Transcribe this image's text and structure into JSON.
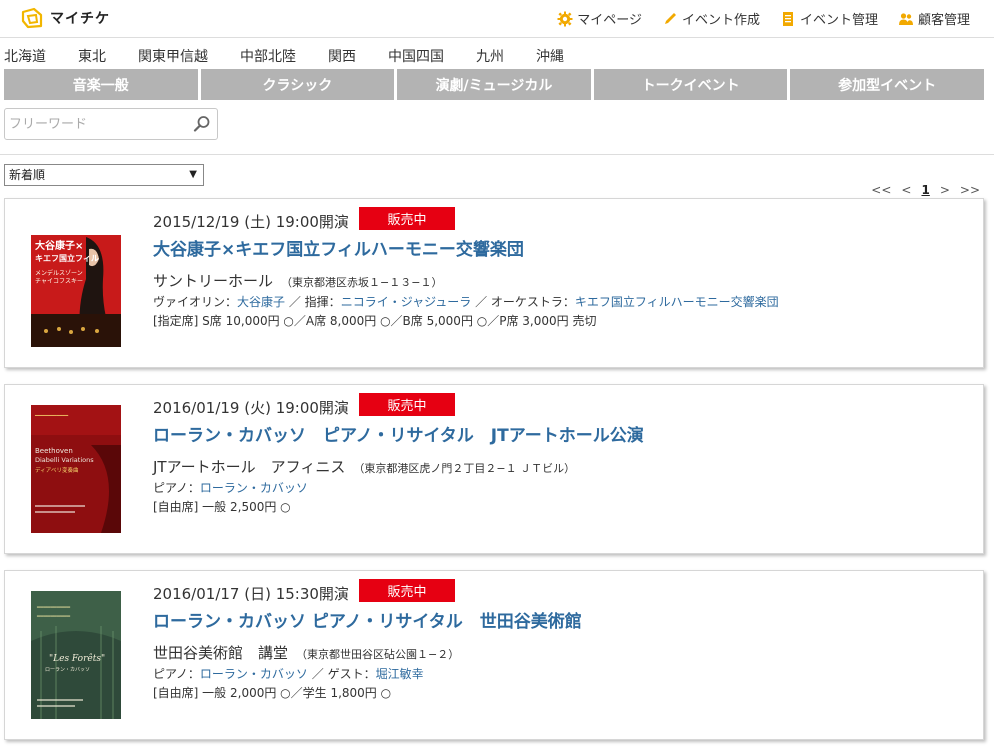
{
  "header": {
    "logo_text": "マイチケ",
    "nav": [
      {
        "label": "マイページ",
        "icon": "gear-icon"
      },
      {
        "label": "イベント作成",
        "icon": "pencil-icon"
      },
      {
        "label": "イベント管理",
        "icon": "document-icon"
      },
      {
        "label": "顧客管理",
        "icon": "users-icon"
      }
    ]
  },
  "regions": [
    "北海道",
    "東北",
    "関東甲信越",
    "中部北陸",
    "関西",
    "中国四国",
    "九州",
    "沖縄"
  ],
  "categories": [
    "音楽一般",
    "クラシック",
    "演劇/ミュージカル",
    "トークイベント",
    "参加型イベント"
  ],
  "search": {
    "placeholder": "フリーワード",
    "value": ""
  },
  "sort": {
    "selected": "新着順"
  },
  "pager": {
    "first": "<<",
    "prev": "<",
    "current": "1",
    "next": ">",
    "last": ">>"
  },
  "colors": {
    "accent_link": "#2e6a9e",
    "badge": "#e60012",
    "tab_bg": "#b3b3b3"
  },
  "events": [
    {
      "date": "2015/12/19 (土) 19:00開演",
      "status": "販売中",
      "title": "大谷康子×キエフ国立フィルハーモニー交響楽団",
      "venue": "サントリーホール",
      "address": "（東京都港区赤坂１−１３−１）",
      "performers": [
        {
          "role": "ヴァイオリン：",
          "name": "大谷康子",
          "sep": " ／ "
        },
        {
          "role": "指揮：",
          "name": "ニコライ・ジャジューラ",
          "sep": " ／ "
        },
        {
          "role": "オーケストラ：",
          "name": "キエフ国立フィルハーモニー交響楽団",
          "sep": ""
        }
      ],
      "price": "[指定席] S席 10,000円 ○／A席 8,000円 ○／B席 5,000円 ○／P席 3,000円 売切",
      "poster_lines": [
        "大谷康子×",
        "キエフ国立フィル",
        "メンデルスゾーン",
        "チャイコフスキー"
      ]
    },
    {
      "date": "2016/01/19 (火) 19:00開演",
      "status": "販売中",
      "title": "ローラン・カバッソ　ピアノ・リサイタル　JTアートホール公演",
      "venue": "JTアートホール　アフィニス",
      "address": "（東京都港区虎ノ門２丁目２−１ ＪＴビル）",
      "performers": [
        {
          "role": "ピアノ：",
          "name": "ローラン・カバッソ",
          "sep": ""
        }
      ],
      "price": "[自由席] 一般 2,500円 ○",
      "poster_lines": [
        "Beethoven",
        "Diabelli Variations",
        "ディアベリ変奏曲"
      ]
    },
    {
      "date": "2016/01/17 (日) 15:30開演",
      "status": "販売中",
      "title": "ローラン・カバッソ ピアノ・リサイタル　世田谷美術館",
      "venue": "世田谷美術館　講堂",
      "address": "（東京都世田谷区砧公園１−２）",
      "performers": [
        {
          "role": "ピアノ：",
          "name": "ローラン・カバッソ",
          "sep": " ／ "
        },
        {
          "role": "ゲスト：",
          "name": "堀江敏幸",
          "sep": ""
        }
      ],
      "price": "[自由席] 一般 2,000円 ○／学生 1,800円 ○",
      "poster_lines": [
        "\"Les Forêts\"",
        "ローラン・カバッソ"
      ]
    }
  ]
}
